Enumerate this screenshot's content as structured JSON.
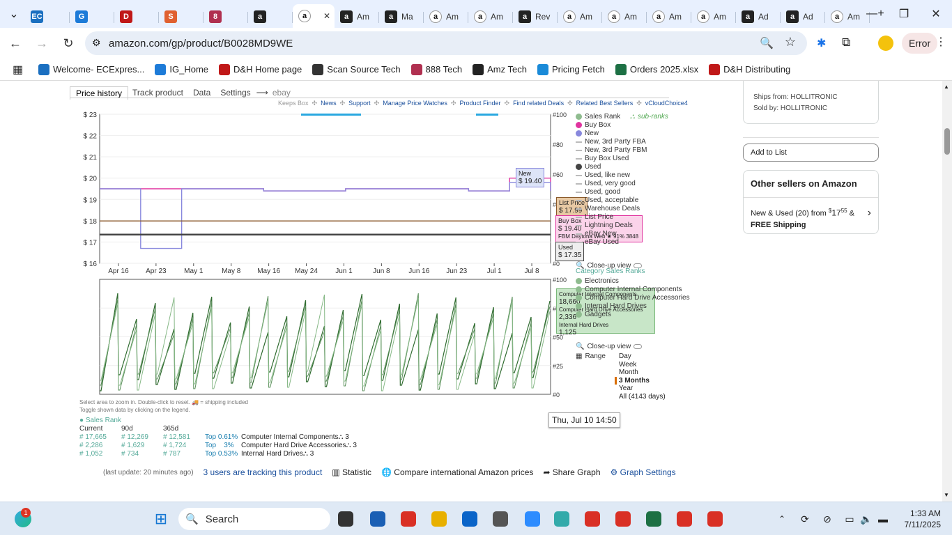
{
  "tabs": [
    {
      "label": "",
      "icon": "ec-icon"
    },
    {
      "label": "",
      "icon": "ig-icon"
    },
    {
      "label": "",
      "icon": "dh-icon"
    },
    {
      "label": "",
      "icon": "s-icon"
    },
    {
      "label": "",
      "icon": "888-icon"
    },
    {
      "label": "",
      "icon": "amz-tech-icon"
    },
    {
      "label": "",
      "icon": "amazon-icon",
      "active": true
    },
    {
      "label": "Am",
      "icon": "amz-tech-icon"
    },
    {
      "label": "Ma",
      "icon": "amz-tech-icon"
    },
    {
      "label": "Am",
      "icon": "amazon-icon"
    },
    {
      "label": "Am",
      "icon": "amazon-icon"
    },
    {
      "label": "Rev",
      "icon": "amz-tech-icon"
    },
    {
      "label": "Am",
      "icon": "amazon-icon"
    },
    {
      "label": "Am",
      "icon": "amazon-icon"
    },
    {
      "label": "Am",
      "icon": "amazon-icon"
    },
    {
      "label": "Am",
      "icon": "amazon-icon"
    },
    {
      "label": "Ad",
      "icon": "amz-tech-icon"
    },
    {
      "label": "Ad",
      "icon": "amz-tech-icon"
    },
    {
      "label": "Am",
      "icon": "amazon-icon"
    }
  ],
  "address": {
    "url": "amazon.com/gp/product/B0028MD9WE",
    "profile_label": "Error"
  },
  "bookmarks": [
    "Welcome- ECExpres...",
    "IG_Home",
    "D&H Home page",
    "Scan Source Tech",
    "888 Tech",
    "Amz Tech",
    "Pricing Fetch",
    "Orders 2025.xlsx",
    "D&H Distributing"
  ],
  "keepa": {
    "tabs": [
      "Price history",
      "Track product",
      "Data",
      "Settings",
      "ebay"
    ],
    "links_prefix": "Keeps Box",
    "links": [
      "News",
      "Support",
      "Manage Price Watches",
      "Product Finder",
      "Find related Deals",
      "Related Best Sellers",
      "vCloudChoice4"
    ],
    "price_axis": [
      "$ 23",
      "$ 22",
      "$ 21",
      "$ 20",
      "$ 19",
      "$ 18",
      "$ 17",
      "$ 16"
    ],
    "rank_axis_right_top": [
      "#100",
      "#80",
      "#60",
      "#40",
      "#0"
    ],
    "rank_axis_right_bottom": [
      "#100",
      "#75",
      "#50",
      "#25",
      "#0"
    ],
    "x_dates": [
      "Apr 16",
      "Apr 23",
      "May 1",
      "May 8",
      "May 16",
      "May 24",
      "Jun 1",
      "Jun 8",
      "Jun 16",
      "Jun 23",
      "Jul 1",
      "Jul 8"
    ],
    "legend_top": [
      {
        "label": "Sales Rank",
        "kind": "dot",
        "color": "#8fbc8f"
      },
      {
        "label": "Buy Box",
        "kind": "dot",
        "color": "#e0349f"
      },
      {
        "label": "New",
        "kind": "dot",
        "color": "#8888dd"
      },
      {
        "label": "New, 3rd Party FBA",
        "kind": "line",
        "color": "#bbbbbb"
      },
      {
        "label": "New, 3rd Party FBM",
        "kind": "line",
        "color": "#bbbbbb"
      },
      {
        "label": "Buy Box Used",
        "kind": "line",
        "color": "#bbbbbb"
      },
      {
        "label": "Used",
        "kind": "dot",
        "color": "#444444"
      },
      {
        "label": "Used, like new",
        "kind": "line",
        "color": "#bbbbbb"
      },
      {
        "label": "Used, very good",
        "kind": "line",
        "color": "#bbbbbb"
      },
      {
        "label": "Used, good",
        "kind": "line",
        "color": "#bbbbbb"
      },
      {
        "label": "Used, acceptable",
        "kind": "line",
        "color": "#bbbbbb"
      },
      {
        "label": "Warehouse Deals",
        "kind": "line",
        "color": "#bbbbbb"
      },
      {
        "label": "List Price",
        "kind": "line",
        "color": "#bbbbbb"
      },
      {
        "label": "Lightning Deals",
        "kind": "line",
        "color": "#bbbbbb"
      },
      {
        "label": "eBay New",
        "kind": "line",
        "color": "#bbbbbb"
      },
      {
        "label": "eBay Used",
        "kind": "line",
        "color": "#bbbbbb"
      }
    ],
    "sub_ranks_label": "sub-ranks",
    "closeup_label": "Close-up view",
    "category_ranks_label": "Category Sales Ranks",
    "legend_bottom": [
      {
        "label": "Electronics",
        "color": "#8fbc8f"
      },
      {
        "label": "Computer Internal Components",
        "color": "#8fbc8f"
      },
      {
        "label": "Computer Hard Drive Accessories",
        "color": "#8fbc8f"
      },
      {
        "label": "Internal Hard Drives",
        "color": "#8fbc8f"
      },
      {
        "label": "Gadgets",
        "color": "#8fbc8f"
      }
    ],
    "range_label": "Range",
    "ranges": [
      "Day",
      "Week",
      "Month",
      "3 Months",
      "Year",
      "All (4143 days)"
    ],
    "tooltip_new": {
      "title": "New",
      "value": "$ 19.40"
    },
    "tooltip_list": {
      "title": "List Price",
      "value": "$ 17.99"
    },
    "tooltip_buybox": {
      "title": "Buy Box",
      "value": "$ 19.40",
      "seller": "FBM  Daytona Web  ★ 91%  3848"
    },
    "tooltip_used": {
      "title": "Used",
      "value": "$ 17.35"
    },
    "tooltip_ranks": [
      {
        "title": "Computer Internal Components",
        "value": "18,660"
      },
      {
        "title": "Computer Hard Drive Accessories",
        "value": "2,336"
      },
      {
        "title": "Internal Hard Drives",
        "value": "1,125"
      }
    ],
    "timestamp": "Thu, Jul 10 14:50",
    "hint1": "Select area to zoom in. Double-click to reset.",
    "hint1b": "= shipping included",
    "hint2": "Toggle shown data by clicking on the legend.",
    "rank_table_title": "Sales Rank",
    "rank_table_headers": [
      "Current",
      "90d",
      "365d"
    ],
    "rank_rows": [
      {
        "cur": "17,665",
        "d90": "12,269",
        "d365": "12,581",
        "top": "Top 0.61%",
        "cat": "Computer Internal Components"
      },
      {
        "cur": "2,286",
        "d90": "1,629",
        "d365": "1,724",
        "top": "Top    3%",
        "cat": "Computer Hard Drive Accessories"
      },
      {
        "cur": "1,052",
        "d90": "734",
        "d365": "787",
        "top": "Top 0.53%",
        "cat": "Internal Hard Drives"
      }
    ],
    "footer": {
      "last_update": "(last update: 20 minutes ago)",
      "tracking": "3 users are tracking this product",
      "statistic": "Statistic",
      "compare": "Compare international Amazon prices",
      "share": "Share Graph",
      "settings": "Graph Settings"
    }
  },
  "sidebar": {
    "ships_from": "Ships from: HOLLITRONIC",
    "sold_by": "Sold by: HOLLITRONIC",
    "add_to_list": "Add to List",
    "other_sellers": "Other sellers on Amazon",
    "new_used": "New & Used (20) from ",
    "price_whole": "17",
    "price_frac": "55",
    "amp": "&",
    "free_shipping": "FREE Shipping"
  },
  "taskbar": {
    "search": "Search",
    "time": "1:33 AM",
    "date": "7/11/2025",
    "badge": "1"
  },
  "chart_data": {
    "type": "line",
    "title": "",
    "xlabel": "",
    "ylabel": "",
    "x": [
      "Apr 16",
      "Apr 23",
      "May 1",
      "May 8",
      "May 16",
      "May 24",
      "Jun 1",
      "Jun 8",
      "Jun 16",
      "Jun 23",
      "Jul 1",
      "Jul 8"
    ],
    "ylim": [
      16,
      23
    ],
    "series": [
      {
        "name": "Buy Box",
        "color": "#e0349f",
        "values": [
          19.5,
          19.5,
          19.5,
          19.5,
          19.4,
          19.4,
          19.5,
          19.5,
          19.5,
          19.4,
          20.0,
          19.4
        ]
      },
      {
        "name": "New",
        "color": "#8888dd",
        "values": [
          19.5,
          16.7,
          19.5,
          19.5,
          19.4,
          19.4,
          19.5,
          19.5,
          19.5,
          19.4,
          19.8,
          19.4
        ]
      },
      {
        "name": "Used",
        "color": "#444444",
        "values": [
          17.35,
          17.35,
          17.35,
          17.35,
          17.35,
          17.35,
          17.35,
          17.35,
          17.35,
          17.35,
          17.35,
          17.35
        ]
      },
      {
        "name": "List Price",
        "color": "#8b5a2b",
        "values": [
          17.99,
          17.99,
          17.99,
          17.99,
          17.99,
          17.99,
          17.99,
          17.99,
          17.99,
          17.99,
          17.99,
          17.99
        ]
      }
    ]
  }
}
